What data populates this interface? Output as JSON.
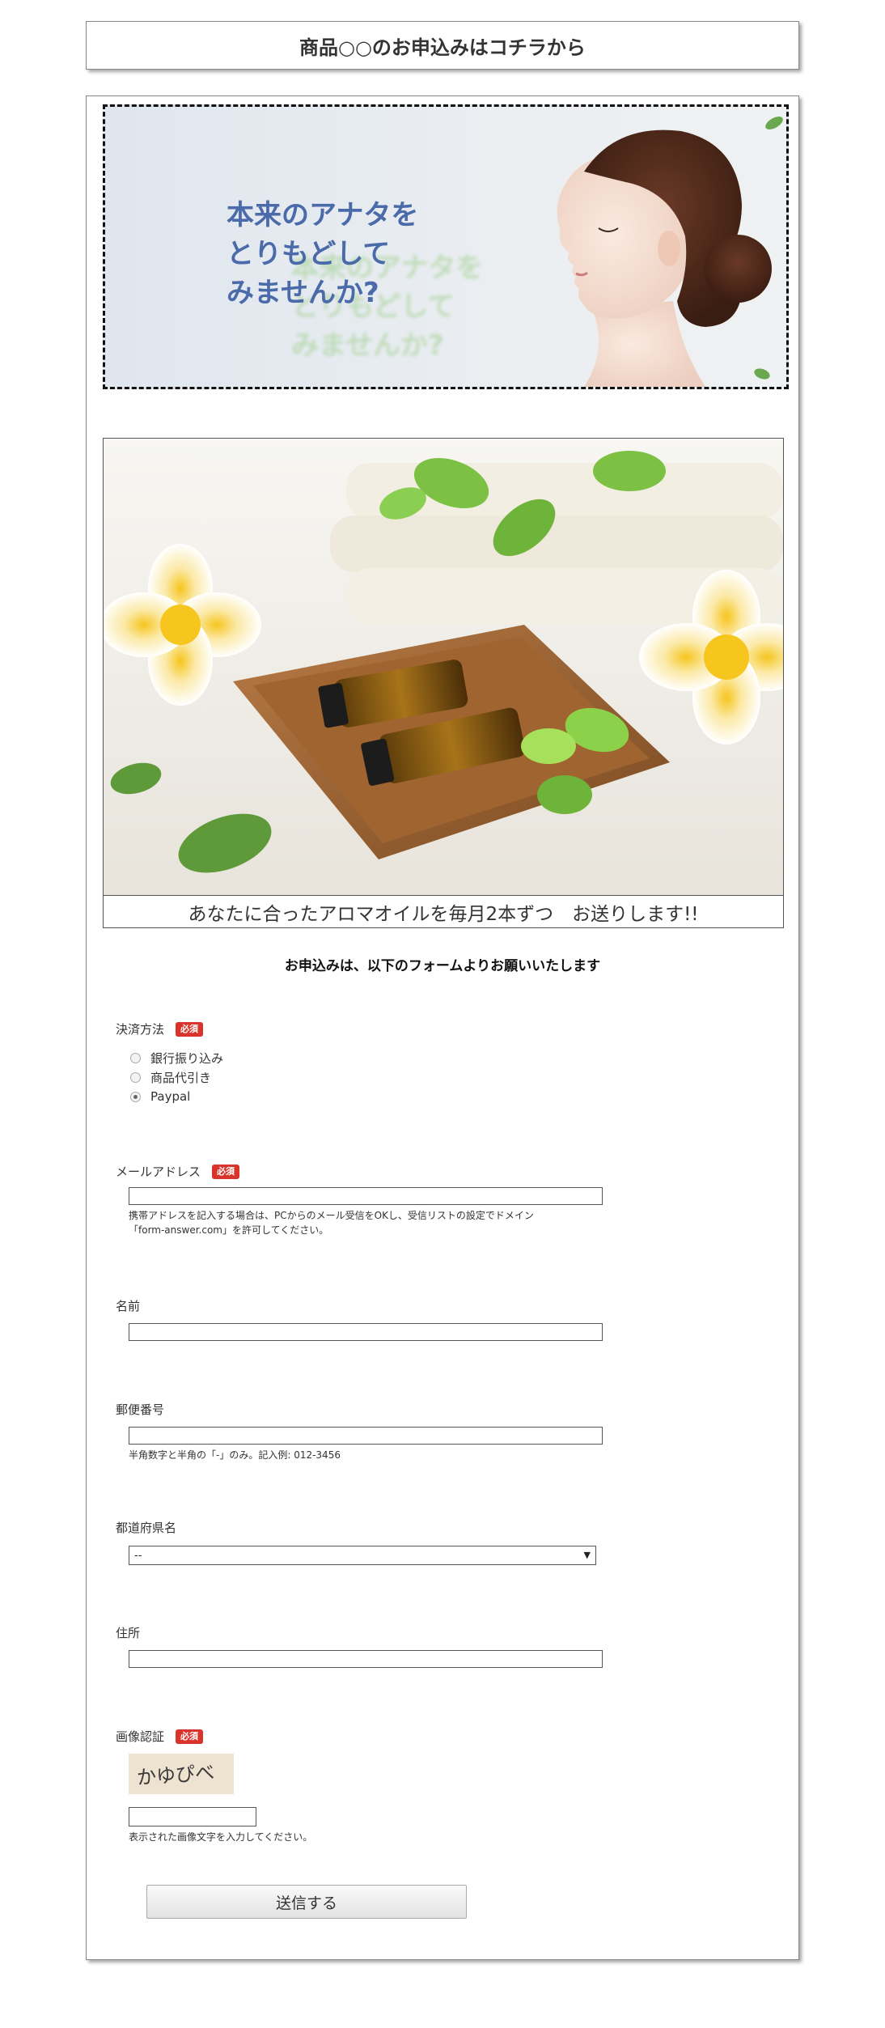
{
  "page": {
    "title": "商品○○のお申込みはコチラから"
  },
  "banner": {
    "text": "本来のアナタを\nとりもどして\nみませんか?"
  },
  "aroma": {
    "caption": "あなたに合ったアロマオイルを毎月2本ずつ　お送りします!!"
  },
  "intro": "お申込みは、以下のフォームよりお願いいたします",
  "form": {
    "required_badge": "必須",
    "payment": {
      "label": "決済方法",
      "options": [
        "銀行振り込み",
        "商品代引き",
        "Paypal"
      ],
      "selected": "Paypal"
    },
    "email": {
      "label": "メールアドレス",
      "value": "",
      "note": "携帯アドレスを記入する場合は、PCからのメール受信をOKし、受信リストの設定でドメイン\n「form-answer.com」を許可してください。"
    },
    "name": {
      "label": "名前",
      "value": ""
    },
    "postal": {
      "label": "郵便番号",
      "value": "",
      "note": "半角数字と半角の「-」のみ。記入例: 012-3456"
    },
    "prefecture": {
      "label": "都道府県名",
      "selected": "--"
    },
    "address": {
      "label": "住所",
      "value": ""
    },
    "captcha": {
      "label": "画像認証",
      "image_text": "かゆぴべ",
      "value": "",
      "note": "表示された画像文字を入力してください。"
    },
    "submit_label": "送信する"
  },
  "colors": {
    "required_badge": "#d9342b",
    "banner_text": "#4a6aaa"
  }
}
